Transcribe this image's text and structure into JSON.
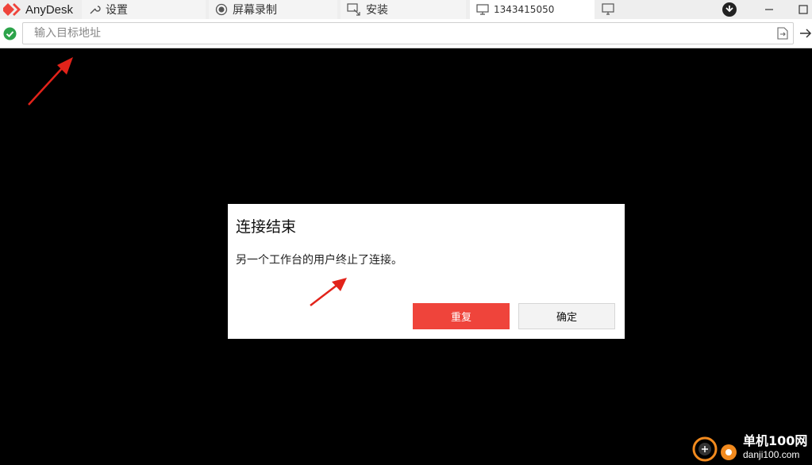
{
  "app": {
    "name": "AnyDesk"
  },
  "tabs": [
    {
      "label": "设置",
      "icon": "wrench-icon"
    },
    {
      "label": "屏幕录制",
      "icon": "record-icon"
    },
    {
      "label": "安装",
      "icon": "install-icon"
    },
    {
      "label": "1343415050",
      "icon": "monitor-icon"
    }
  ],
  "address_bar": {
    "placeholder": "输入目标地址",
    "value": ""
  },
  "dialog": {
    "title": "连接结束",
    "message": "另一个工作台的用户终止了连接。",
    "primary_button": "重复",
    "secondary_button": "确定"
  },
  "watermark": {
    "main": "单机100网",
    "sub": "danji100.com"
  },
  "colors": {
    "brand": "#ef443b",
    "status_ok": "#2ca34a",
    "background": "#000000"
  }
}
